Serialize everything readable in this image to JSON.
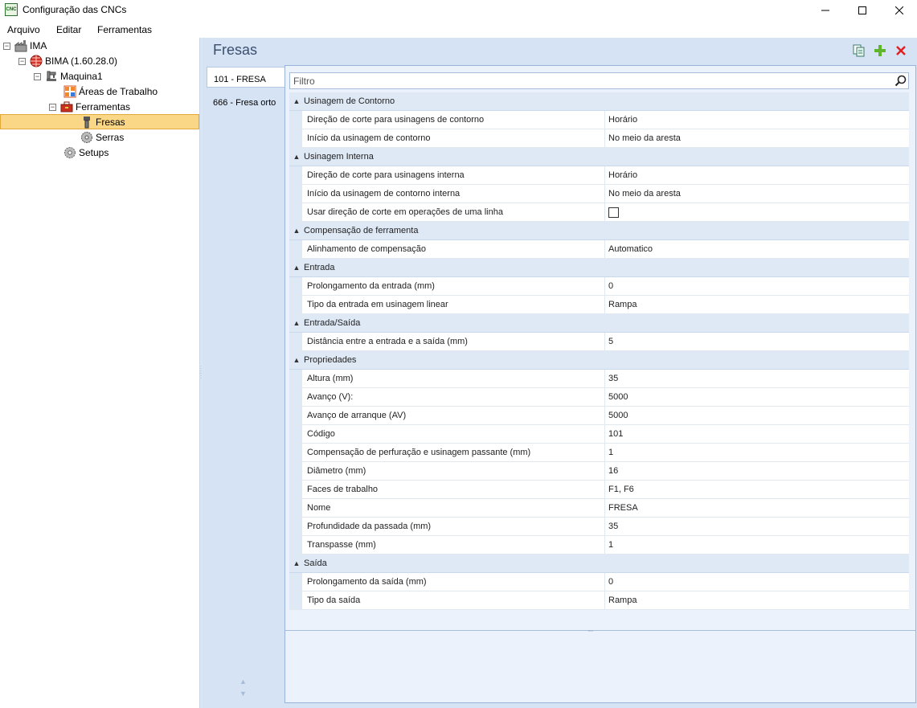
{
  "window": {
    "title": "Configuração das CNCs",
    "icon_text": "CNC"
  },
  "menu": {
    "items": [
      "Arquivo",
      "Editar",
      "Ferramentas"
    ]
  },
  "tree": {
    "root": "IMA",
    "machine_group": "BIMA (1.60.28.0)",
    "machine": "Maquina1",
    "work_areas": "Áreas de Trabalho",
    "tools": "Ferramentas",
    "mills": "Fresas",
    "saws": "Serras",
    "setups": "Setups"
  },
  "panel": {
    "title": "Fresas"
  },
  "tool_list": [
    "101 - FRESA",
    "666 - Fresa orto"
  ],
  "filter": {
    "placeholder": "Filtro"
  },
  "categories": [
    {
      "name": "Usinagem de Contorno",
      "props": [
        {
          "name": "Direção de corte para usinagens de contorno",
          "value": "Horário"
        },
        {
          "name": "Início da usinagem de contorno",
          "value": "No meio da aresta"
        }
      ]
    },
    {
      "name": "Usinagem Interna",
      "props": [
        {
          "name": "Direção de corte para usinagens interna",
          "value": "Horário"
        },
        {
          "name": "Início da usinagem de contorno interna",
          "value": "No meio da aresta"
        },
        {
          "name": "Usar direção de corte em operações de uma linha",
          "value": "",
          "checkbox": true
        }
      ]
    },
    {
      "name": "Compensação de ferramenta",
      "props": [
        {
          "name": "Alinhamento de compensação",
          "value": "Automatico"
        }
      ]
    },
    {
      "name": "Entrada",
      "props": [
        {
          "name": "Prolongamento da entrada (mm)",
          "value": "0"
        },
        {
          "name": "Tipo da entrada em usinagem linear",
          "value": "Rampa"
        }
      ]
    },
    {
      "name": "Entrada/Saída",
      "props": [
        {
          "name": "Distância entre a entrada e a saída (mm)",
          "value": "5"
        }
      ]
    },
    {
      "name": "Propriedades",
      "props": [
        {
          "name": "Altura (mm)",
          "value": "35"
        },
        {
          "name": "Avanço (V):",
          "value": "5000"
        },
        {
          "name": "Avanço de arranque (AV)",
          "value": "5000"
        },
        {
          "name": "Código",
          "value": "101"
        },
        {
          "name": "Compensação de perfuração e usinagem passante (mm)",
          "value": "1"
        },
        {
          "name": "Diâmetro (mm)",
          "value": "16"
        },
        {
          "name": "Faces de trabalho",
          "value": "F1, F6"
        },
        {
          "name": "Nome",
          "value": "FRESA"
        },
        {
          "name": "Profundidade da passada (mm)",
          "value": "35"
        },
        {
          "name": "Transpasse (mm)",
          "value": "1"
        }
      ]
    },
    {
      "name": "Saída",
      "props": [
        {
          "name": "Prolongamento da saída (mm)",
          "value": "0"
        },
        {
          "name": "Tipo da saída",
          "value": "Rampa"
        }
      ]
    }
  ]
}
